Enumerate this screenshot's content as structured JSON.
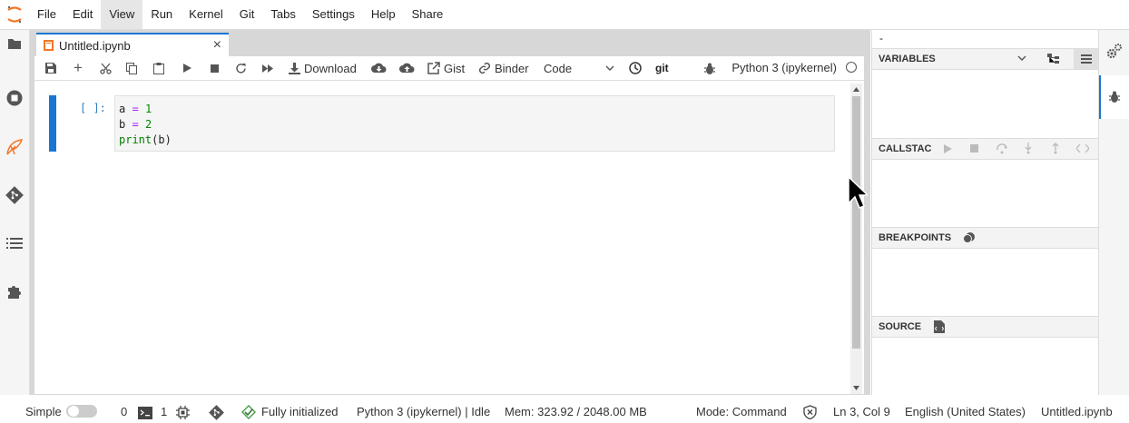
{
  "menu": [
    "File",
    "Edit",
    "View",
    "Run",
    "Kernel",
    "Git",
    "Tabs",
    "Settings",
    "Help",
    "Share"
  ],
  "tab": {
    "title": "Untitled.ipynb",
    "close": "×"
  },
  "toolbar": {
    "download": "Download",
    "gist": "Gist",
    "binder": "Binder",
    "cell_type": "Code",
    "git": "git",
    "kernel": "Python 3 (ipykernel)"
  },
  "cell": {
    "prompt": "[ ]:",
    "lines": [
      [
        "a",
        "=",
        "1"
      ],
      [
        "b",
        "=",
        "2"
      ]
    ],
    "line3_fn": "print",
    "line3_arg": "(b)"
  },
  "right_panel": {
    "dash": "-",
    "variables": "VARIABLES",
    "callstack": "CALLSTAC",
    "breakpoints": "BREAKPOINTS",
    "source": "SOURCE"
  },
  "status": {
    "mode_label": "Simple",
    "terminals": "0",
    "kernels": "1",
    "init": "Fully initialized",
    "kernel_status": "Python 3 (ipykernel) | Idle",
    "mem": "Mem: 323.92 / 2048.00 MB",
    "cmd_mode": "Mode: Command",
    "cursor": "Ln 3, Col 9",
    "lang": "English (United States)",
    "file": "Untitled.ipynb"
  },
  "colors": {
    "accent": "#1976d2",
    "jupyter_orange": "#f37626"
  }
}
